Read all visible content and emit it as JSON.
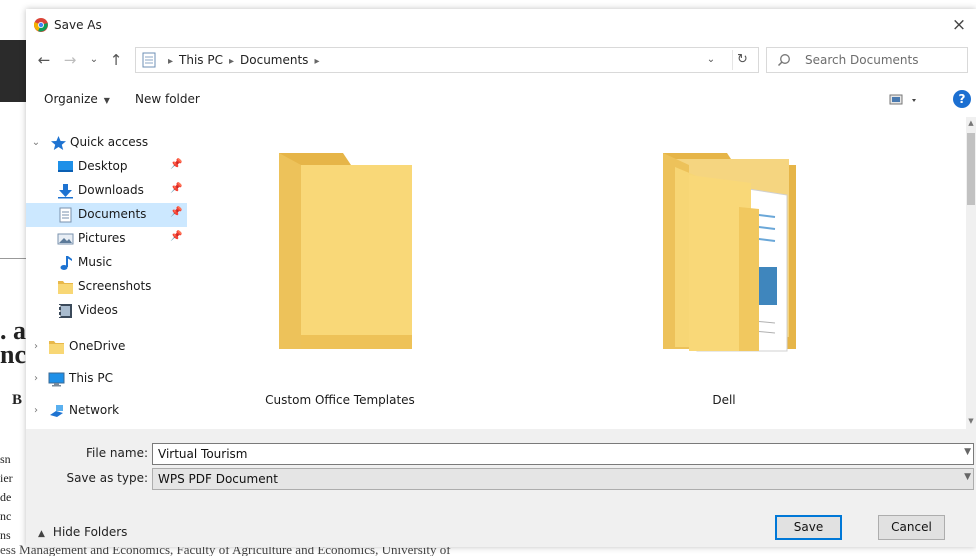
{
  "background_doc": {
    "fragments": [
      ". a",
      "nc",
      "B",
      "sn",
      "ier",
      "de",
      "nc",
      "ns"
    ],
    "bottom_line": "ess Management and Economics, Faculty of Agriculture and Economics, University of"
  },
  "dialog": {
    "title": "Save As",
    "close_glyph": "×"
  },
  "nav": {
    "back": "←",
    "forward": "→",
    "recent": "⌄",
    "up": "↑",
    "breadcrumbs": [
      "This PC",
      "Documents"
    ],
    "address_dropdown": "⌄",
    "refresh": "↻",
    "search_placeholder": "Search Documents"
  },
  "toolbar": {
    "organize_label": "Organize",
    "new_folder_label": "New folder",
    "help": "?"
  },
  "sidebar": {
    "items": [
      {
        "label": "Quick access",
        "icon": "star-icon",
        "chevron": "⌄",
        "pinned": false
      },
      {
        "label": "Desktop",
        "icon": "desktop-icon",
        "pinned": true
      },
      {
        "label": "Downloads",
        "icon": "download-icon",
        "pinned": true
      },
      {
        "label": "Documents",
        "icon": "documents-icon",
        "pinned": true,
        "selected": true
      },
      {
        "label": "Pictures",
        "icon": "pictures-icon",
        "pinned": true
      },
      {
        "label": "Music",
        "icon": "music-icon",
        "pinned": false
      },
      {
        "label": "Screenshots",
        "icon": "folder-icon",
        "pinned": false
      },
      {
        "label": "Videos",
        "icon": "videos-icon",
        "pinned": false
      },
      {
        "label": "OneDrive",
        "icon": "folder-icon",
        "chevron": "›"
      },
      {
        "label": "This PC",
        "icon": "computer-icon",
        "chevron": "›"
      },
      {
        "label": "Network",
        "icon": "network-icon",
        "chevron": "›"
      }
    ]
  },
  "content": {
    "folders": [
      {
        "name": "Custom Office Templates",
        "icon": "empty-folder-icon"
      },
      {
        "name": "Dell",
        "icon": "full-folder-icon"
      }
    ]
  },
  "form": {
    "file_name_label": "File name:",
    "file_name_value": "Virtual Tourism",
    "save_type_label": "Save as type:",
    "save_type_value": "WPS PDF Document"
  },
  "footer": {
    "hide_folders_label": "Hide Folders",
    "save_label": "Save",
    "cancel_label": "Cancel"
  },
  "colors": {
    "selected_bg": "#cce8ff",
    "accent": "#0078d7",
    "folder_yellow": "#f8d775"
  }
}
